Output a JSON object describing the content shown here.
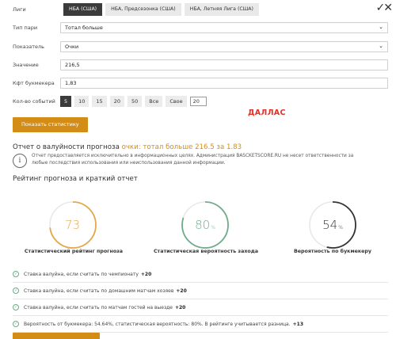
{
  "leagues": {
    "label": "Лиги",
    "tabs": [
      "НБА (США)",
      "НБА, Предсезонка (США)",
      "НБА, Летняя Лига (США)"
    ],
    "active_index": 0,
    "checks_glyph": "✓✕"
  },
  "form": {
    "bet_type": {
      "label": "Тип пари",
      "value": "Тотал больше"
    },
    "indicator": {
      "label": "Показатель",
      "value": "Очки"
    },
    "value": {
      "label": "Значение",
      "value": "216,5"
    },
    "odds": {
      "label": "Кфт букмекера",
      "value": "1,83"
    },
    "events": {
      "label": "Кол-во событий",
      "options": [
        "5",
        "10",
        "15",
        "20",
        "50",
        "Все",
        "Свое"
      ],
      "active_index": 0,
      "custom_value": "20"
    },
    "submit_label": "Показать статистику"
  },
  "overlay_text": "ДАЛЛАС",
  "report": {
    "title_prefix": "Отчет о валуйности прогноза",
    "title_highlight": "очки: тотал больше 216.5 за 1.83",
    "disclaimer": "Отчет предоставляется исключительно в информационных целях. Администрация BASCKETSCORE.RU не несет ответственности за любые последствия использования или неиспользования данной информации."
  },
  "rating": {
    "title": "Рейтинг прогноза и краткий отчет",
    "gauges": [
      {
        "value": "73",
        "suffix": "",
        "label": "Статистический рейтинг прогноза",
        "color": "#e2a94b",
        "fraction": 0.73
      },
      {
        "value": "80",
        "suffix": "%",
        "label": "Статистическая вероятность захода",
        "color": "#6fab88",
        "fraction": 0.8
      },
      {
        "value": "54",
        "suffix": "%",
        "label": "Вероятность по букмекеру",
        "color": "#333333",
        "fraction": 0.54
      }
    ]
  },
  "summary": [
    {
      "text": "Ставка валуйна, если считать по чемпионату",
      "bonus": "+20"
    },
    {
      "text": "Ставка валуйна, если считать по домашним матчам хозяев",
      "bonus": "+20"
    },
    {
      "text": "Ставка валуйна, если считать по матчам гостей на выезде",
      "bonus": "+20"
    },
    {
      "text": "Вероятность от букмекера: 54.64%, статистическая вероятность: 80%. В рейтинге учитывается разница.",
      "bonus": "+13"
    }
  ],
  "colors": {
    "accent": "#d38d17",
    "overlay": "#e0312a",
    "dark": "#3b3b3b"
  }
}
